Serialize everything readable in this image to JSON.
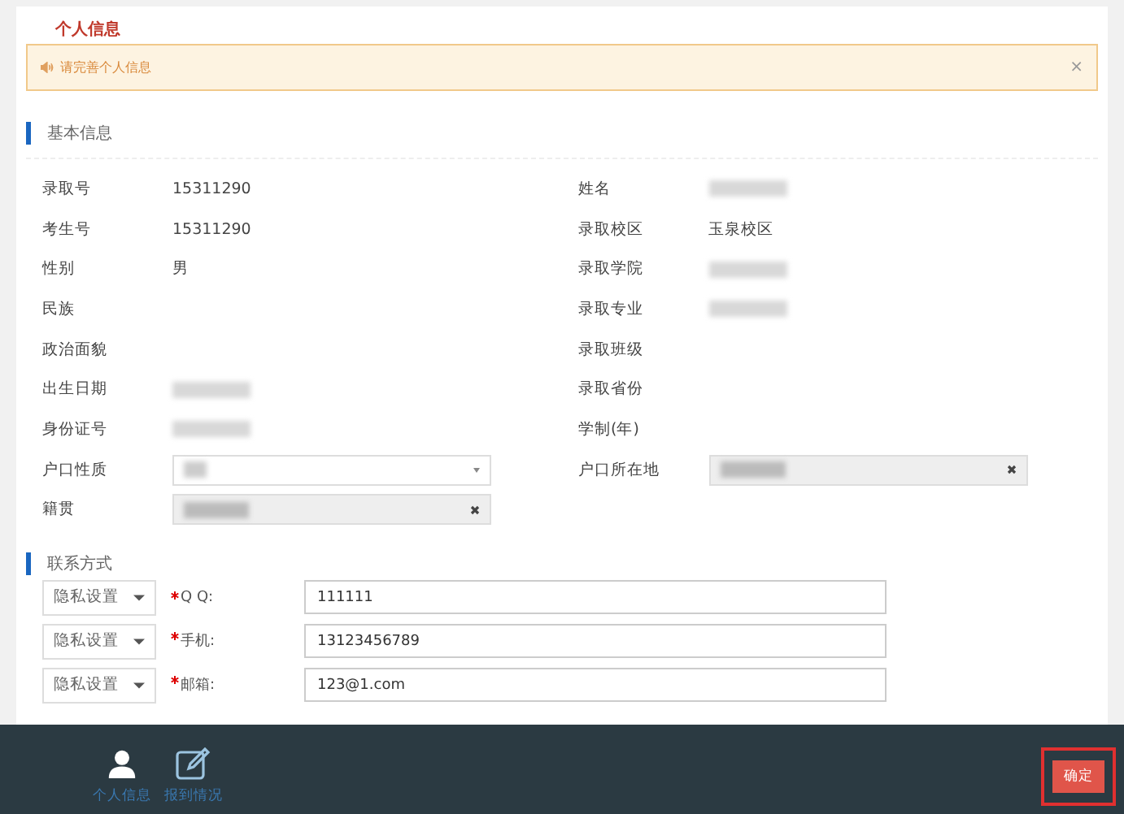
{
  "page_title": "个人信息",
  "alert": {
    "text": "请完善个人信息",
    "close": "×"
  },
  "basic_section": {
    "title": "基本信息",
    "left": [
      {
        "label": "录取号",
        "value": "15311290",
        "kind": "text"
      },
      {
        "label": "考生号",
        "value": "15311290",
        "kind": "text"
      },
      {
        "label": "性别",
        "value": "男",
        "kind": "text"
      },
      {
        "label": "民族",
        "kind": "text"
      },
      {
        "label": "政治面貌",
        "kind": "text"
      },
      {
        "label": "出生日期",
        "kind": "redacted"
      },
      {
        "label": "身份证号",
        "kind": "redacted"
      },
      {
        "label": "户口性质",
        "kind": "select"
      },
      {
        "label": "籍贯",
        "kind": "clearable"
      }
    ],
    "right": [
      {
        "label": "姓名",
        "kind": "redacted"
      },
      {
        "label": "录取校区",
        "value": "玉泉校区",
        "kind": "text"
      },
      {
        "label": "录取学院",
        "kind": "redacted"
      },
      {
        "label": "录取专业",
        "kind": "redacted"
      },
      {
        "label": "录取班级",
        "kind": "text"
      },
      {
        "label": "录取省份",
        "kind": "text"
      },
      {
        "label": "学制(年)",
        "kind": "text"
      },
      {
        "label": "户口所在地",
        "kind": "clearable"
      }
    ]
  },
  "contact_section": {
    "title": "联系方式",
    "rows": [
      {
        "privacy": "隐私设置",
        "label": "Q Q:",
        "required": true,
        "value": "111111"
      },
      {
        "privacy": "隐私设置",
        "label": "手机:",
        "required": true,
        "value": "13123456789"
      },
      {
        "privacy": "隐私设置",
        "label": "邮箱:",
        "required": true,
        "value": "123@1.com"
      }
    ]
  },
  "bottom_nav": [
    {
      "label": "个人信息",
      "kind": "person"
    },
    {
      "label": "报到情况",
      "kind": "edit"
    }
  ],
  "confirm_button": "确定"
}
